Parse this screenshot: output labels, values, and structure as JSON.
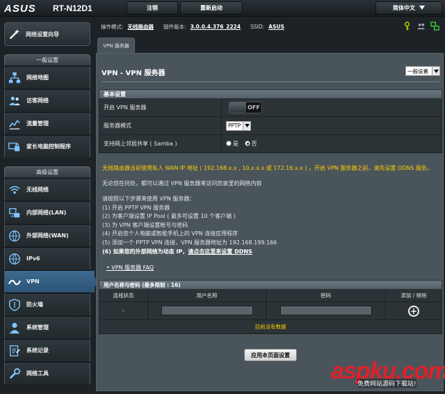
{
  "header": {
    "logo": "ASUS",
    "model": "RT-N12D1",
    "logout_label": "注销",
    "reboot_label": "重新启动",
    "language_label": "简体中文"
  },
  "status": {
    "mode_label": "操作模式:",
    "mode_value": "无线路由器",
    "firmware_label": "固件版本:",
    "firmware_value": "3.0.0.4.376_2224",
    "ssid_label": "SSID:",
    "ssid_value": "ASUS"
  },
  "sidebar": {
    "quick_setup": "网络设置向导",
    "general_header": "一般设置",
    "general_items": [
      {
        "label": "网络地图",
        "icon": "network-map-icon"
      },
      {
        "label": "访客网络",
        "icon": "guest-network-icon"
      },
      {
        "label": "流量管理",
        "icon": "traffic-manager-icon"
      },
      {
        "label": "家长电脑控制程序",
        "icon": "parental-control-icon"
      }
    ],
    "advanced_header": "高级设置",
    "advanced_items": [
      {
        "label": "无线网络",
        "icon": "wireless-icon"
      },
      {
        "label": "内部网络(LAN)",
        "icon": "lan-icon"
      },
      {
        "label": "外部网络(WAN)",
        "icon": "wan-icon"
      },
      {
        "label": "IPv6",
        "icon": "ipv6-icon"
      },
      {
        "label": "VPN",
        "icon": "vpn-icon",
        "active": true
      },
      {
        "label": "防火墙",
        "icon": "firewall-icon"
      },
      {
        "label": "系统管理",
        "icon": "administration-icon"
      },
      {
        "label": "系统记录",
        "icon": "system-log-icon"
      },
      {
        "label": "网络工具",
        "icon": "network-tools-icon"
      }
    ]
  },
  "tab": {
    "label": "VPN 服务器"
  },
  "main": {
    "title": "VPN - VPN 服务器",
    "title_select": "一般设置",
    "basic_section": "基本设置",
    "rows": {
      "enable_label": "开启 VPN 服务器",
      "enable_state": "OFF",
      "mode_label": "服务器模式",
      "mode_value": "PPTP",
      "samba_label": "支持网上邻居共享 ( Samba )",
      "samba_yes": "是",
      "samba_no": "否"
    },
    "warning": "无线路由器当前使用私人 WAN IP 地址 ( 192.168.x.x , 10.x.x.x 或 172.16.x.x ) 。开启 VPN 服务器之前，请先设置 DDNS 服务。",
    "intro": "无论您在何处，都可以通过 VPN 服务器来访问您家里的网络内容",
    "steps_intro": "请按照以下步骤来使用 VPN 服务器：",
    "steps": [
      "(1) 开启 PPTP VPN 服务器",
      "(2) 为客户端设置 IP Pool ( 最多可设置 10 个客户端 )",
      "(3) 为 VPN 客户端设置帐号与密码",
      "(4) 开启您个人电脑或智能手机上的 VPN 连接应用程序",
      "(5) 添加一个 PPTP VPN 连接，VPN 服务器地址为 192.168.199.166"
    ],
    "step6_bold": "(6) 如果您的外部网络为动态 IP，",
    "step6_link": "请点击这里来设置 DDNS",
    "faq": "VPN 服务器 FAQ",
    "users_section": "用户名称与密码 (最多限制 : 16)",
    "columns": [
      "连线状态",
      "用户名称",
      "密码",
      "添加 / 移除"
    ],
    "status_dash": "-",
    "no_data": "目前没有数据",
    "apply": "应用本页面设置"
  },
  "watermark": {
    "text": "aspku.com",
    "sub": "免费网站源码下载站!"
  },
  "colors": {
    "accent": "#2f5a7d",
    "warning": "#ffcc00"
  }
}
